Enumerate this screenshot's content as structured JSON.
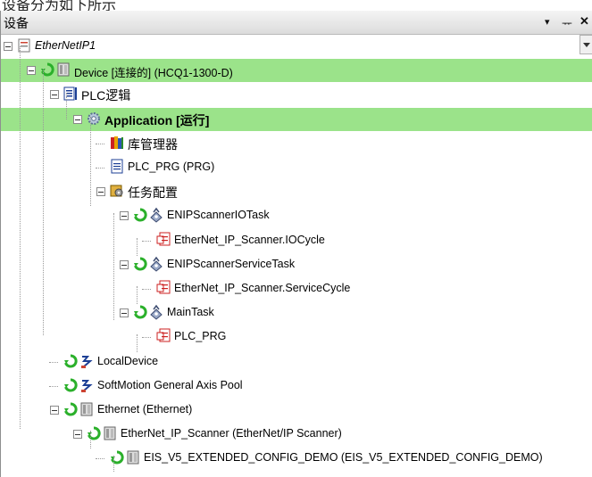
{
  "caption": "设备分为如下所示",
  "panel": {
    "title": "设备",
    "controls": {
      "dropdown": "▾",
      "pin": "ᅲ",
      "close": "✕"
    }
  },
  "tree": [
    {
      "label": "EtherNetIP1",
      "italic": true,
      "icon": "project-icon"
    },
    {
      "label": "Device [连接的] (HCQ1-1300-D)",
      "icon": "device-icon",
      "status": "connected",
      "highlight": true
    },
    {
      "label": "PLC逻辑",
      "icon": "plc-logic-icon"
    },
    {
      "label": "Application [运行]",
      "icon": "application-gear-icon",
      "bold": true,
      "highlight": true
    },
    {
      "label": "库管理器",
      "icon": "library-manager-icon"
    },
    {
      "label": "PLC_PRG (PRG)",
      "icon": "pou-icon"
    },
    {
      "label": "任务配置",
      "icon": "task-config-icon"
    },
    {
      "label": "ENIPScannerIOTask",
      "icon": "task-icon",
      "status": "connected"
    },
    {
      "label": "EtherNet_IP_Scanner.IOCycle",
      "icon": "task-call-icon"
    },
    {
      "label": "ENIPScannerServiceTask",
      "icon": "task-icon",
      "status": "connected"
    },
    {
      "label": "EtherNet_IP_Scanner.ServiceCycle",
      "icon": "task-call-icon"
    },
    {
      "label": "MainTask",
      "icon": "task-icon",
      "status": "connected"
    },
    {
      "label": "PLC_PRG",
      "icon": "task-call-icon"
    },
    {
      "label": "LocalDevice",
      "icon": "axis-icon",
      "status": "connected"
    },
    {
      "label": "SoftMotion General Axis Pool",
      "icon": "axis-icon",
      "status": "connected"
    },
    {
      "label": "Ethernet (Ethernet)",
      "icon": "device-icon",
      "status": "connected"
    },
    {
      "label": "EtherNet_IP_Scanner (EtherNet/IP Scanner)",
      "icon": "device-icon",
      "status": "connected"
    },
    {
      "label": "EIS_V5_EXTENDED_CONFIG_DEMO (EIS_V5_EXTENDED_CONFIG_DEMO)",
      "icon": "device-icon",
      "status": "connected"
    }
  ]
}
